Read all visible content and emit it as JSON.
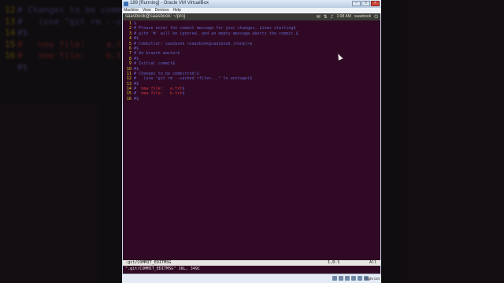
{
  "window": {
    "title": "189 [Running] - Oracle VM VirtualBox",
    "buttons": [
      "–",
      "□",
      "×"
    ]
  },
  "vm_menu": [
    "Machine",
    "View",
    "Devices",
    "Help"
  ],
  "guest_panel": {
    "title": "saasbook@saasbook: ~/proj",
    "time": "1:08 AM",
    "user": "saasbook",
    "icons": [
      "mail-icon",
      "network-icon",
      "volume-icon",
      "power-icon"
    ]
  },
  "editor": {
    "lines": [
      {
        "n": "1",
        "parts": [
          {
            "t": "$",
            "c": "dollar"
          }
        ]
      },
      {
        "n": "2",
        "parts": [
          {
            "t": "# Please enter the commit message for your changes. Lines starting",
            "c": "blue"
          },
          {
            "t": "$",
            "c": "dollar"
          }
        ]
      },
      {
        "n": "3",
        "parts": [
          {
            "t": "# with '#' will be ignored, and an empty message aborts the commit.",
            "c": "blue"
          },
          {
            "t": "$",
            "c": "dollar"
          }
        ]
      },
      {
        "n": "4",
        "parts": [
          {
            "t": "#",
            "c": "blue"
          },
          {
            "t": "$",
            "c": "dollar"
          }
        ]
      },
      {
        "n": "5",
        "parts": [
          {
            "t": "# Committer: saasbook <saasbook@saasbook.(none)>",
            "c": "blue"
          },
          {
            "t": "$",
            "c": "dollar"
          }
        ]
      },
      {
        "n": "6",
        "parts": [
          {
            "t": "#",
            "c": "blue"
          },
          {
            "t": "$",
            "c": "dollar"
          }
        ]
      },
      {
        "n": "7",
        "parts": [
          {
            "t": "# On branch master",
            "c": "blue"
          },
          {
            "t": "$",
            "c": "dollar"
          }
        ]
      },
      {
        "n": "8",
        "parts": [
          {
            "t": "#",
            "c": "blue"
          },
          {
            "t": "$",
            "c": "dollar"
          }
        ]
      },
      {
        "n": "9",
        "parts": [
          {
            "t": "# Initial commit",
            "c": "blue"
          },
          {
            "t": "$",
            "c": "dollar"
          }
        ]
      },
      {
        "n": "10",
        "parts": [
          {
            "t": "#",
            "c": "blue"
          },
          {
            "t": "$",
            "c": "dollar"
          }
        ]
      },
      {
        "n": "11",
        "parts": [
          {
            "t": "# Changes to be committed:",
            "c": "blue"
          },
          {
            "t": "$",
            "c": "dollar"
          }
        ]
      },
      {
        "n": "12",
        "parts": [
          {
            "t": "#   (use \"git rm --cached <file>...\" to unstage)",
            "c": "blue"
          },
          {
            "t": "$",
            "c": "dollar"
          }
        ]
      },
      {
        "n": "13",
        "parts": [
          {
            "t": "#",
            "c": "blue"
          },
          {
            "t": "$",
            "c": "dollar"
          }
        ]
      },
      {
        "n": "14",
        "parts": [
          {
            "t": "#",
            "c": "blue"
          },
          {
            "t": "\tnew file:   ",
            "c": "red"
          },
          {
            "t": "a.txt",
            "c": "red"
          },
          {
            "t": "$",
            "c": "dollar"
          }
        ]
      },
      {
        "n": "15",
        "parts": [
          {
            "t": "#",
            "c": "blue"
          },
          {
            "t": "\tnew file:   ",
            "c": "red"
          },
          {
            "t": "b.txt",
            "c": "red"
          },
          {
            "t": "$",
            "c": "dollar"
          }
        ]
      },
      {
        "n": "16",
        "parts": [
          {
            "t": "#",
            "c": "blue"
          },
          {
            "t": "$",
            "c": "dollar"
          }
        ]
      }
    ],
    "status_file": ".git/COMMIT_EDITMSG",
    "status_pos": "1,0-1",
    "status_pct": "All",
    "message": "\".git/COMMIT_EDITMSG\" 16L, 349C"
  },
  "vm_statusbar": {
    "host_key": "Right Ctrl"
  },
  "background": {
    "lines": [
      {
        "n": "12",
        "text": "# Changes to be committed:",
        "c": "blue"
      },
      {
        "n": "13",
        "text": "#   (use \"git rm --cac",
        "c": "blue"
      },
      {
        "n": "14",
        "text": "#$",
        "c": "blue"
      },
      {
        "n": "15",
        "text": "#   new file:    a.txt$",
        "c": "red"
      },
      {
        "n": "16",
        "text": "#   new file:    b.txt$",
        "c": "red"
      },
      {
        "n": "",
        "text": "#$",
        "c": "blue"
      }
    ]
  }
}
